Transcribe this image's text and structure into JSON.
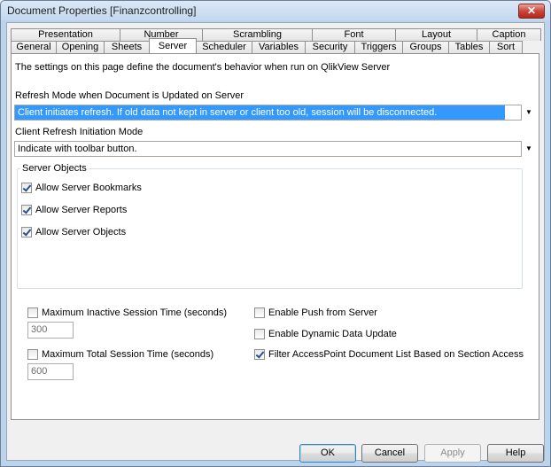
{
  "window": {
    "title": "Document Properties [Finanzcontrolling]",
    "close_glyph": "✕"
  },
  "tabs": {
    "row1": [
      "Presentation",
      "Number",
      "Scrambling",
      "Font",
      "Layout",
      "Caption"
    ],
    "row2": [
      "General",
      "Opening",
      "Sheets",
      "Server",
      "Scheduler",
      "Variables",
      "Security",
      "Triggers",
      "Groups",
      "Tables",
      "Sort"
    ],
    "active": "Server"
  },
  "server_page": {
    "intro": "The settings on this page define the document's behavior when run on QlikView Server",
    "refresh_mode_label": "Refresh Mode when Document is Updated on Server",
    "refresh_mode_value": "Client initiates refresh. If old data not kept in server or client too old, session will be disconnected.",
    "client_refresh_label": "Client Refresh Initiation Mode",
    "client_refresh_value": "Indicate with toolbar button.",
    "server_objects": {
      "legend": "Server Objects",
      "allow_bookmarks": "Allow Server Bookmarks",
      "allow_reports": "Allow Server Reports",
      "allow_objects": "Allow Server Objects"
    },
    "max_inactive_label": "Maximum Inactive Session Time (seconds)",
    "max_inactive_value": "300",
    "max_total_label": "Maximum Total Session Time (seconds)",
    "max_total_value": "600",
    "enable_push_label": "Enable Push from Server",
    "enable_dynamic_label": "Enable Dynamic Data Update",
    "filter_accesspoint_label": "Filter AccessPoint Document List Based on Section Access"
  },
  "buttons": {
    "ok": "OK",
    "cancel": "Cancel",
    "apply": "Apply",
    "help": "Help"
  },
  "icons": {
    "dropdown": "▼"
  }
}
